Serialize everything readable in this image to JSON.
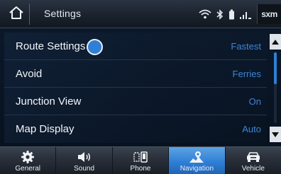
{
  "header": {
    "title": "Settings",
    "home_icon": "home-icon",
    "status_icons": [
      "wifi-icon",
      "bluetooth-icon",
      "battery-icon",
      "signal-icon"
    ],
    "sxm_label": "sxm"
  },
  "list": {
    "rows": [
      {
        "label": "Route Settings",
        "value": "Fastest"
      },
      {
        "label": "Avoid",
        "value": "Ferries"
      },
      {
        "label": "Junction View",
        "value": "On"
      },
      {
        "label": "Map Display",
        "value": "Auto"
      }
    ],
    "value_color": "#3b86d6"
  },
  "scrollbar": {
    "up_icon": "caret-up-icon",
    "down_icon": "caret-down-icon",
    "position": 0.0,
    "visible_fraction": 0.45
  },
  "tabs": [
    {
      "label": "General",
      "icon": "gear-icon",
      "active": false
    },
    {
      "label": "Sound",
      "icon": "speaker-icon",
      "active": false
    },
    {
      "label": "Phone",
      "icon": "phone-icon",
      "active": false
    },
    {
      "label": "Navigation",
      "icon": "navigation-icon",
      "active": true
    },
    {
      "label": "Vehicle",
      "icon": "car-icon",
      "active": false
    }
  ],
  "colors": {
    "accent": "#2f7fd6",
    "background": "#0a1626"
  }
}
